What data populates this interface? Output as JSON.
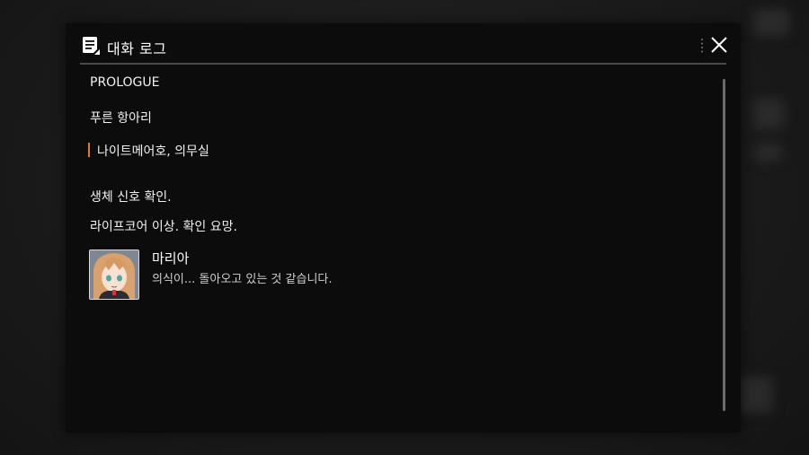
{
  "dialog": {
    "title": "대화 로그",
    "close_icon": "close-icon",
    "log_icon": "log-document-icon"
  },
  "log": {
    "chapter": "PROLOGUE",
    "episode": "푸른 항아리",
    "location": "나이트메어호, 의무실",
    "lines": [
      "생체 신호 확인.",
      "라이프코어 이상. 확인 요망."
    ],
    "dialogue": {
      "speaker": "마리아",
      "text": "의식이... 돌아오고 있는 것 같습니다."
    }
  },
  "colors": {
    "panel": "#0c0c0c",
    "accent": "#e07a2a",
    "text": "#f2f2f2"
  }
}
